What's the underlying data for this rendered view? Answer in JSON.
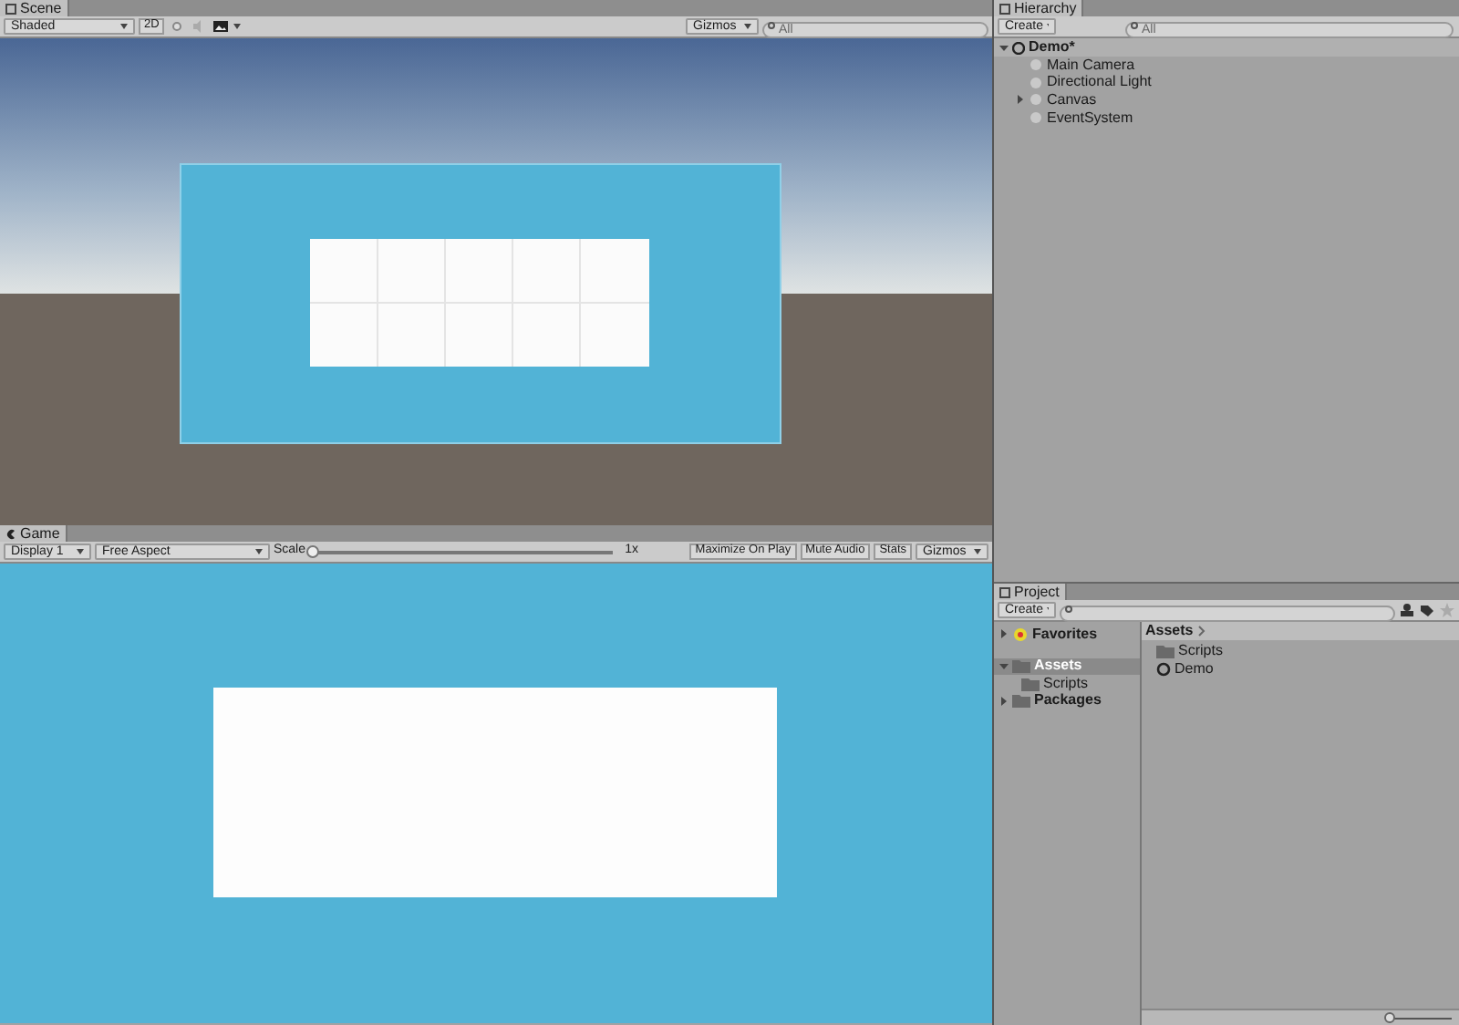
{
  "scene": {
    "tab": "Scene",
    "shading": "Shaded",
    "toggle_2d": "2D",
    "gizmos": "Gizmos",
    "search": {
      "placeholder": "All"
    },
    "view": {
      "kind": "picture"
    }
  },
  "game": {
    "tab": "Game",
    "display": "Display 1",
    "aspect": "Free Aspect",
    "scale_label": "Scale",
    "scale": {
      "level": 0.0
    },
    "scale_reading": "1x",
    "buttons": [
      "Maximize On Play",
      "Mute Audio",
      "Stats"
    ],
    "gizmos": "Gizmos",
    "view": {
      "kind": "picture"
    }
  },
  "hierarchy": {
    "tab": "Hierarchy",
    "create": "Create",
    "search": {
      "placeholder": "All"
    },
    "scene": {
      "label": "Demo*",
      "expanded": true
    },
    "items": [
      {
        "label": "Main Camera",
        "has_children": false
      },
      {
        "label": "Directional Light",
        "has_children": false
      },
      {
        "label": "Canvas",
        "has_children": true
      },
      {
        "label": "EventSystem",
        "has_children": false
      }
    ]
  },
  "project": {
    "tab": "Project",
    "create": "Create",
    "tree": [
      {
        "label": "Favorites",
        "kind": "favorites",
        "expanded": false,
        "selected": false
      },
      {
        "label": "Assets",
        "kind": "folder",
        "expanded": true,
        "selected": true,
        "children": [
          {
            "label": "Scripts",
            "kind": "folder",
            "selected": false
          }
        ]
      },
      {
        "label": "Packages",
        "kind": "folder",
        "expanded": false,
        "selected": false
      }
    ],
    "breadcrumb": "Assets",
    "files": [
      {
        "label": "Scripts",
        "kind": "folder"
      },
      {
        "label": "Demo",
        "kind": "scene"
      }
    ],
    "zoom": {
      "level": 0.0
    }
  }
}
